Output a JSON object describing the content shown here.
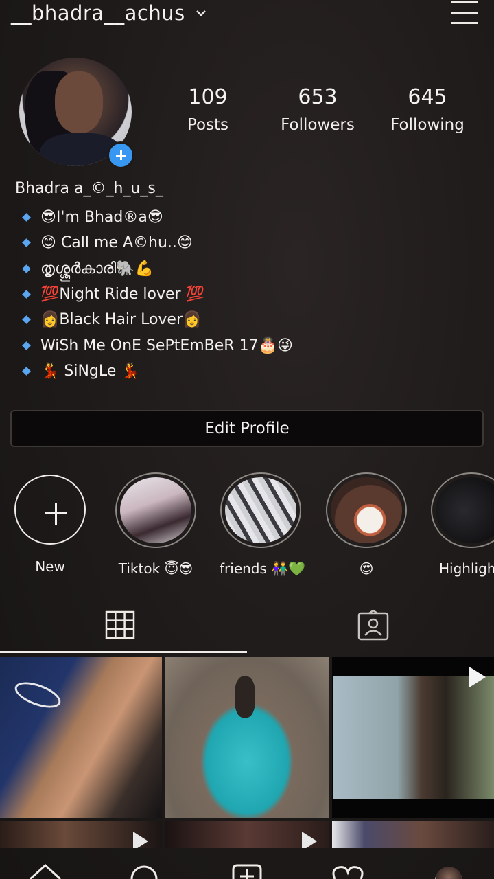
{
  "header": {
    "username": "__bhadra__achus",
    "dropdown_icon": "chevron-down-icon",
    "menu_icon": "hamburger-menu-icon"
  },
  "profile": {
    "stats": [
      {
        "value": "109",
        "label": "Posts"
      },
      {
        "value": "653",
        "label": "Followers"
      },
      {
        "value": "645",
        "label": "Following"
      }
    ],
    "display_name": "Bhadra a_©_h_u_s_",
    "bio": [
      "😎I'm Bhad®a😎",
      "😊 Call me A©hu..😊",
      "തൃശ്ശൂർകാരി🐘💪",
      "💯Night Ride lover 💯",
      "👩Black Hair Lover👩",
      "WiSh Me OnE SePtEmBeR 17🎂😜",
      "💃 SiNgLe 💃"
    ],
    "edit_button": "Edit Profile"
  },
  "highlights": [
    {
      "label": "New"
    },
    {
      "label": "Tiktok 😇😎"
    },
    {
      "label": "friends 👫💚"
    },
    {
      "label": "😍"
    },
    {
      "label": "Highlights"
    }
  ],
  "tabs": {
    "grid_icon": "grid-icon",
    "tagged_icon": "tagged-person-icon"
  },
  "colors": {
    "accent_blue": "#3897f0",
    "background": "#1e1a1a"
  }
}
